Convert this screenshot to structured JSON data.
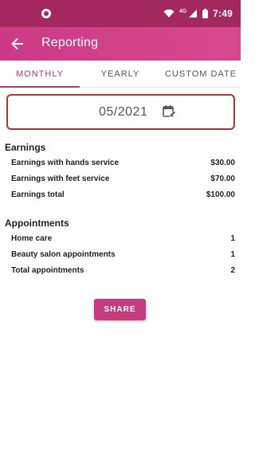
{
  "status_bar": {
    "time": "7:49",
    "network": "4G"
  },
  "app_bar": {
    "title": "Reporting"
  },
  "tabs": [
    {
      "label": "MONTHLY",
      "active": true
    },
    {
      "label": "YEARLY",
      "active": false
    },
    {
      "label": "CUSTOM DATE",
      "active": false
    }
  ],
  "date_field": {
    "value": "05/2021"
  },
  "earnings": {
    "title": "Earnings",
    "rows": [
      {
        "label": "Earnings with hands service",
        "value": "$30.00"
      },
      {
        "label": "Earnings with feet service",
        "value": "$70.00"
      },
      {
        "label": "Earnings total",
        "value": "$100.00"
      }
    ]
  },
  "appointments": {
    "title": "Appointments",
    "rows": [
      {
        "label": "Home care",
        "value": "1"
      },
      {
        "label": "Beauty salon appointments",
        "value": "1"
      },
      {
        "label": "Total appointments",
        "value": "2"
      }
    ]
  },
  "share_button": {
    "label": "SHARE"
  },
  "colors": {
    "status_bar": "#a3285f",
    "app_bar": "#cb3a86",
    "accent": "#b23a72",
    "date_border": "#b23434",
    "share_button": "#c73b7f"
  }
}
